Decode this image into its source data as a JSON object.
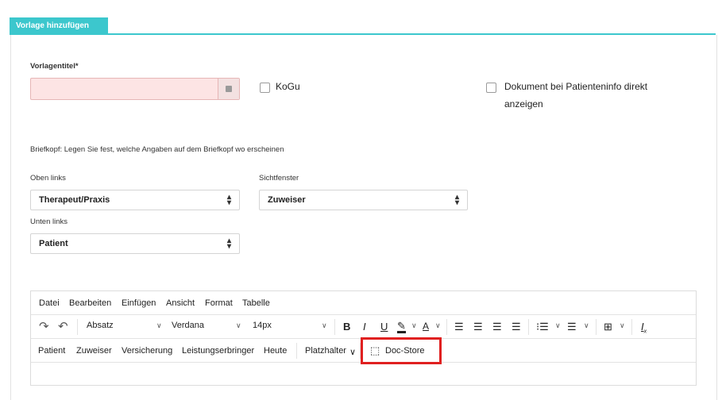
{
  "tab": {
    "label": "Vorlage hinzufügen"
  },
  "form": {
    "title_label": "Vorlagentitel*",
    "title_value": "",
    "kogu_label": "KoGu",
    "doc_label_line1": "Dokument bei Patienteninfo direkt",
    "doc_label_line2": "anzeigen",
    "briefkopf_label": "Briefkopf: Legen Sie fest, welche Angaben auf dem Briefkopf wo erscheinen",
    "oben_links_label": "Oben links",
    "oben_links_value": "Therapeut/Praxis",
    "sichtfenster_label": "Sichtfenster",
    "sichtfenster_value": "Zuweiser",
    "unten_links_label": "Unten links",
    "unten_links_value": "Patient"
  },
  "editor": {
    "menu": [
      "Datei",
      "Bearbeiten",
      "Einfügen",
      "Ansicht",
      "Format",
      "Tabelle"
    ],
    "block_format": "Absatz",
    "font_family": "Verdana",
    "font_size": "14px",
    "bold": "B",
    "italic": "I",
    "underline": "U",
    "placeholders": [
      "Patient",
      "Zuweiser",
      "Versicherung",
      "Leistungserbringer",
      "Heute"
    ],
    "platzhalter_label": "Platzhalter",
    "docstore_label": "Doc-Store"
  },
  "colors": {
    "accent": "#3cc7cd",
    "highlight": "#e02020",
    "error_bg": "#fde4e4"
  }
}
